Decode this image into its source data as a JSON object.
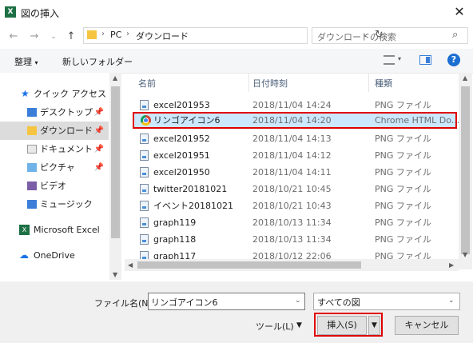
{
  "window": {
    "title": "図の挿入",
    "app_icon": "excel-icon"
  },
  "nav": {
    "breadcrumb": [
      "PC",
      "ダウンロード"
    ],
    "search_placeholder": "ダウンロードの検索"
  },
  "toolbar": {
    "organize": "整理",
    "new_folder": "新しいフォルダー"
  },
  "sidebar": {
    "items": [
      {
        "label": "クイック アクセス",
        "icon": "star-icon",
        "pinned": false
      },
      {
        "label": "デスクトップ",
        "icon": "folder-icon",
        "pinned": true
      },
      {
        "label": "ダウンロード",
        "icon": "download-folder-icon",
        "pinned": true,
        "selected": true
      },
      {
        "label": "ドキュメント",
        "icon": "folder-icon",
        "pinned": true
      },
      {
        "label": "ピクチャ",
        "icon": "folder-icon",
        "pinned": true
      },
      {
        "label": "ビデオ",
        "icon": "folder-icon",
        "pinned": false
      },
      {
        "label": "ミュージック",
        "icon": "folder-icon",
        "pinned": false
      },
      {
        "label": "Microsoft Excel",
        "icon": "excel-icon",
        "pinned": false
      },
      {
        "label": "OneDrive",
        "icon": "cloud-icon",
        "pinned": false
      }
    ]
  },
  "columns": {
    "name": "名前",
    "date": "日付時刻",
    "type": "種類"
  },
  "files": [
    {
      "name": "excel201953",
      "date": "2018/11/04 14:24",
      "type": "PNG ファイル"
    },
    {
      "name": "リンゴアイコン6",
      "date": "2018/11/04 14:20",
      "type": "Chrome HTML Do...",
      "selected": true
    },
    {
      "name": "excel201952",
      "date": "2018/11/04 14:13",
      "type": "PNG ファイル"
    },
    {
      "name": "excel201951",
      "date": "2018/11/04 14:12",
      "type": "PNG ファイル"
    },
    {
      "name": "excel201950",
      "date": "2018/11/04 14:11",
      "type": "PNG ファイル"
    },
    {
      "name": "twitter20181021",
      "date": "2018/10/21 10:45",
      "type": "PNG ファイル"
    },
    {
      "name": "イベント20181021",
      "date": "2018/10/21 10:43",
      "type": "PNG ファイル"
    },
    {
      "name": "graph119",
      "date": "2018/10/13 11:34",
      "type": "PNG ファイル"
    },
    {
      "name": "graph118",
      "date": "2018/10/13 11:34",
      "type": "PNG ファイル"
    },
    {
      "name": "graph117",
      "date": "2018/10/12 22:06",
      "type": "PNG ファイル"
    }
  ],
  "footer": {
    "filename_label": "ファイル名(N):",
    "filename_value": "リンゴアイコン6",
    "filetype_value": "すべての図",
    "tools_label": "ツール(L)",
    "insert_label": "挿入(S)",
    "cancel_label": "キャンセル"
  }
}
